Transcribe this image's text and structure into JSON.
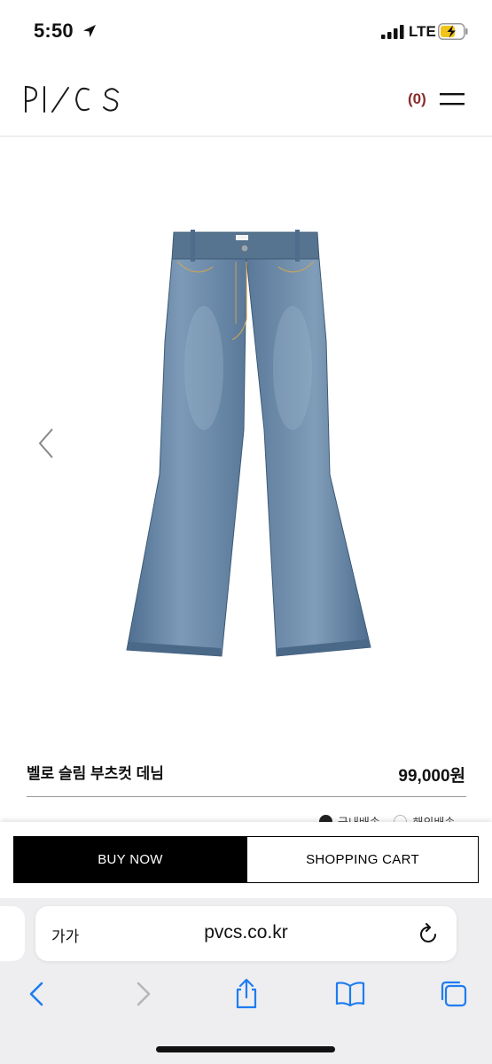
{
  "status_bar": {
    "time": "5:50",
    "network": "LTE"
  },
  "header": {
    "brand": "PVCS",
    "cart_count": "(0)"
  },
  "product": {
    "name": "벨로 슬림 부츠컷 데님",
    "price": "99,000원",
    "shipping_options": [
      {
        "label": "국내배송",
        "selected": true
      },
      {
        "label": "해외배송",
        "selected": false
      }
    ]
  },
  "actions": {
    "buy_now": "BUY NOW",
    "shopping_cart": "SHOPPING CART"
  },
  "browser": {
    "text_size": "가가",
    "url": "pvcs.co.kr"
  },
  "colors": {
    "cart_count": "#8b2a2a",
    "denim": "#5f7d9e",
    "safari_bar": "#eeeef0",
    "ios_blue": "#1e7cf0"
  }
}
